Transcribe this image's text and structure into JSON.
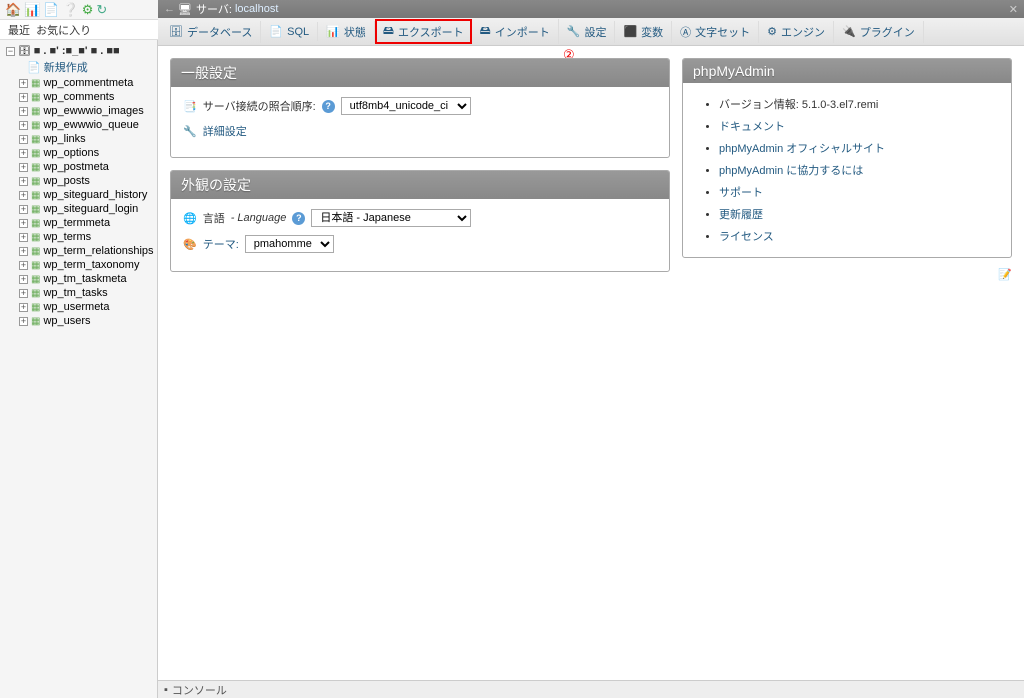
{
  "recent": {
    "label1": "最近",
    "label2": "お気に入り"
  },
  "server": {
    "prefix": "サーバ:",
    "name": "localhost"
  },
  "tabs": [
    {
      "id": "databases",
      "label": "データベース",
      "icon": "🗄"
    },
    {
      "id": "sql",
      "label": "SQL",
      "icon": "📄"
    },
    {
      "id": "status",
      "label": "状態",
      "icon": "📊"
    },
    {
      "id": "export",
      "label": "エクスポート",
      "icon": "🖴",
      "highlighted": true
    },
    {
      "id": "import",
      "label": "インポート",
      "icon": "🖴"
    },
    {
      "id": "settings",
      "label": "設定",
      "icon": "🔧"
    },
    {
      "id": "variables",
      "label": "変数",
      "icon": "⬛"
    },
    {
      "id": "charsets",
      "label": "文字セット",
      "icon": "Ⓐ"
    },
    {
      "id": "engines",
      "label": "エンジン",
      "icon": "⚙"
    },
    {
      "id": "plugins",
      "label": "プラグイン",
      "icon": "🔌"
    }
  ],
  "annotation": "②",
  "general": {
    "title": "一般設定",
    "collation_label": "サーバ接続の照合順序:",
    "collation_value": "utf8mb4_unicode_ci",
    "detail_link": "詳細設定"
  },
  "appearance": {
    "title": "外観の設定",
    "lang_label_jp": "言語",
    "lang_label_en": " - Language",
    "lang_value": "日本語 - Japanese",
    "theme_label": "テーマ:",
    "theme_value": "pmahomme"
  },
  "pma": {
    "title": "phpMyAdmin",
    "version_label": "バージョン情報:",
    "version_value": "5.1.0-3.el7.remi",
    "links": [
      "ドキュメント",
      "phpMyAdmin オフィシャルサイト",
      "phpMyAdmin に協力するには",
      "サポート",
      "更新履歴",
      "ライセンス"
    ]
  },
  "tree": {
    "db_name": "■ . ■' :■_■' ■ . ■■",
    "new_label": "新規作成",
    "tables": [
      "wp_commentmeta",
      "wp_comments",
      "wp_ewwwio_images",
      "wp_ewwwio_queue",
      "wp_links",
      "wp_options",
      "wp_postmeta",
      "wp_posts",
      "wp_siteguard_history",
      "wp_siteguard_login",
      "wp_termmeta",
      "wp_terms",
      "wp_term_relationships",
      "wp_term_taxonomy",
      "wp_tm_taskmeta",
      "wp_tm_tasks",
      "wp_usermeta",
      "wp_users"
    ]
  },
  "console": {
    "label": "コンソール"
  }
}
